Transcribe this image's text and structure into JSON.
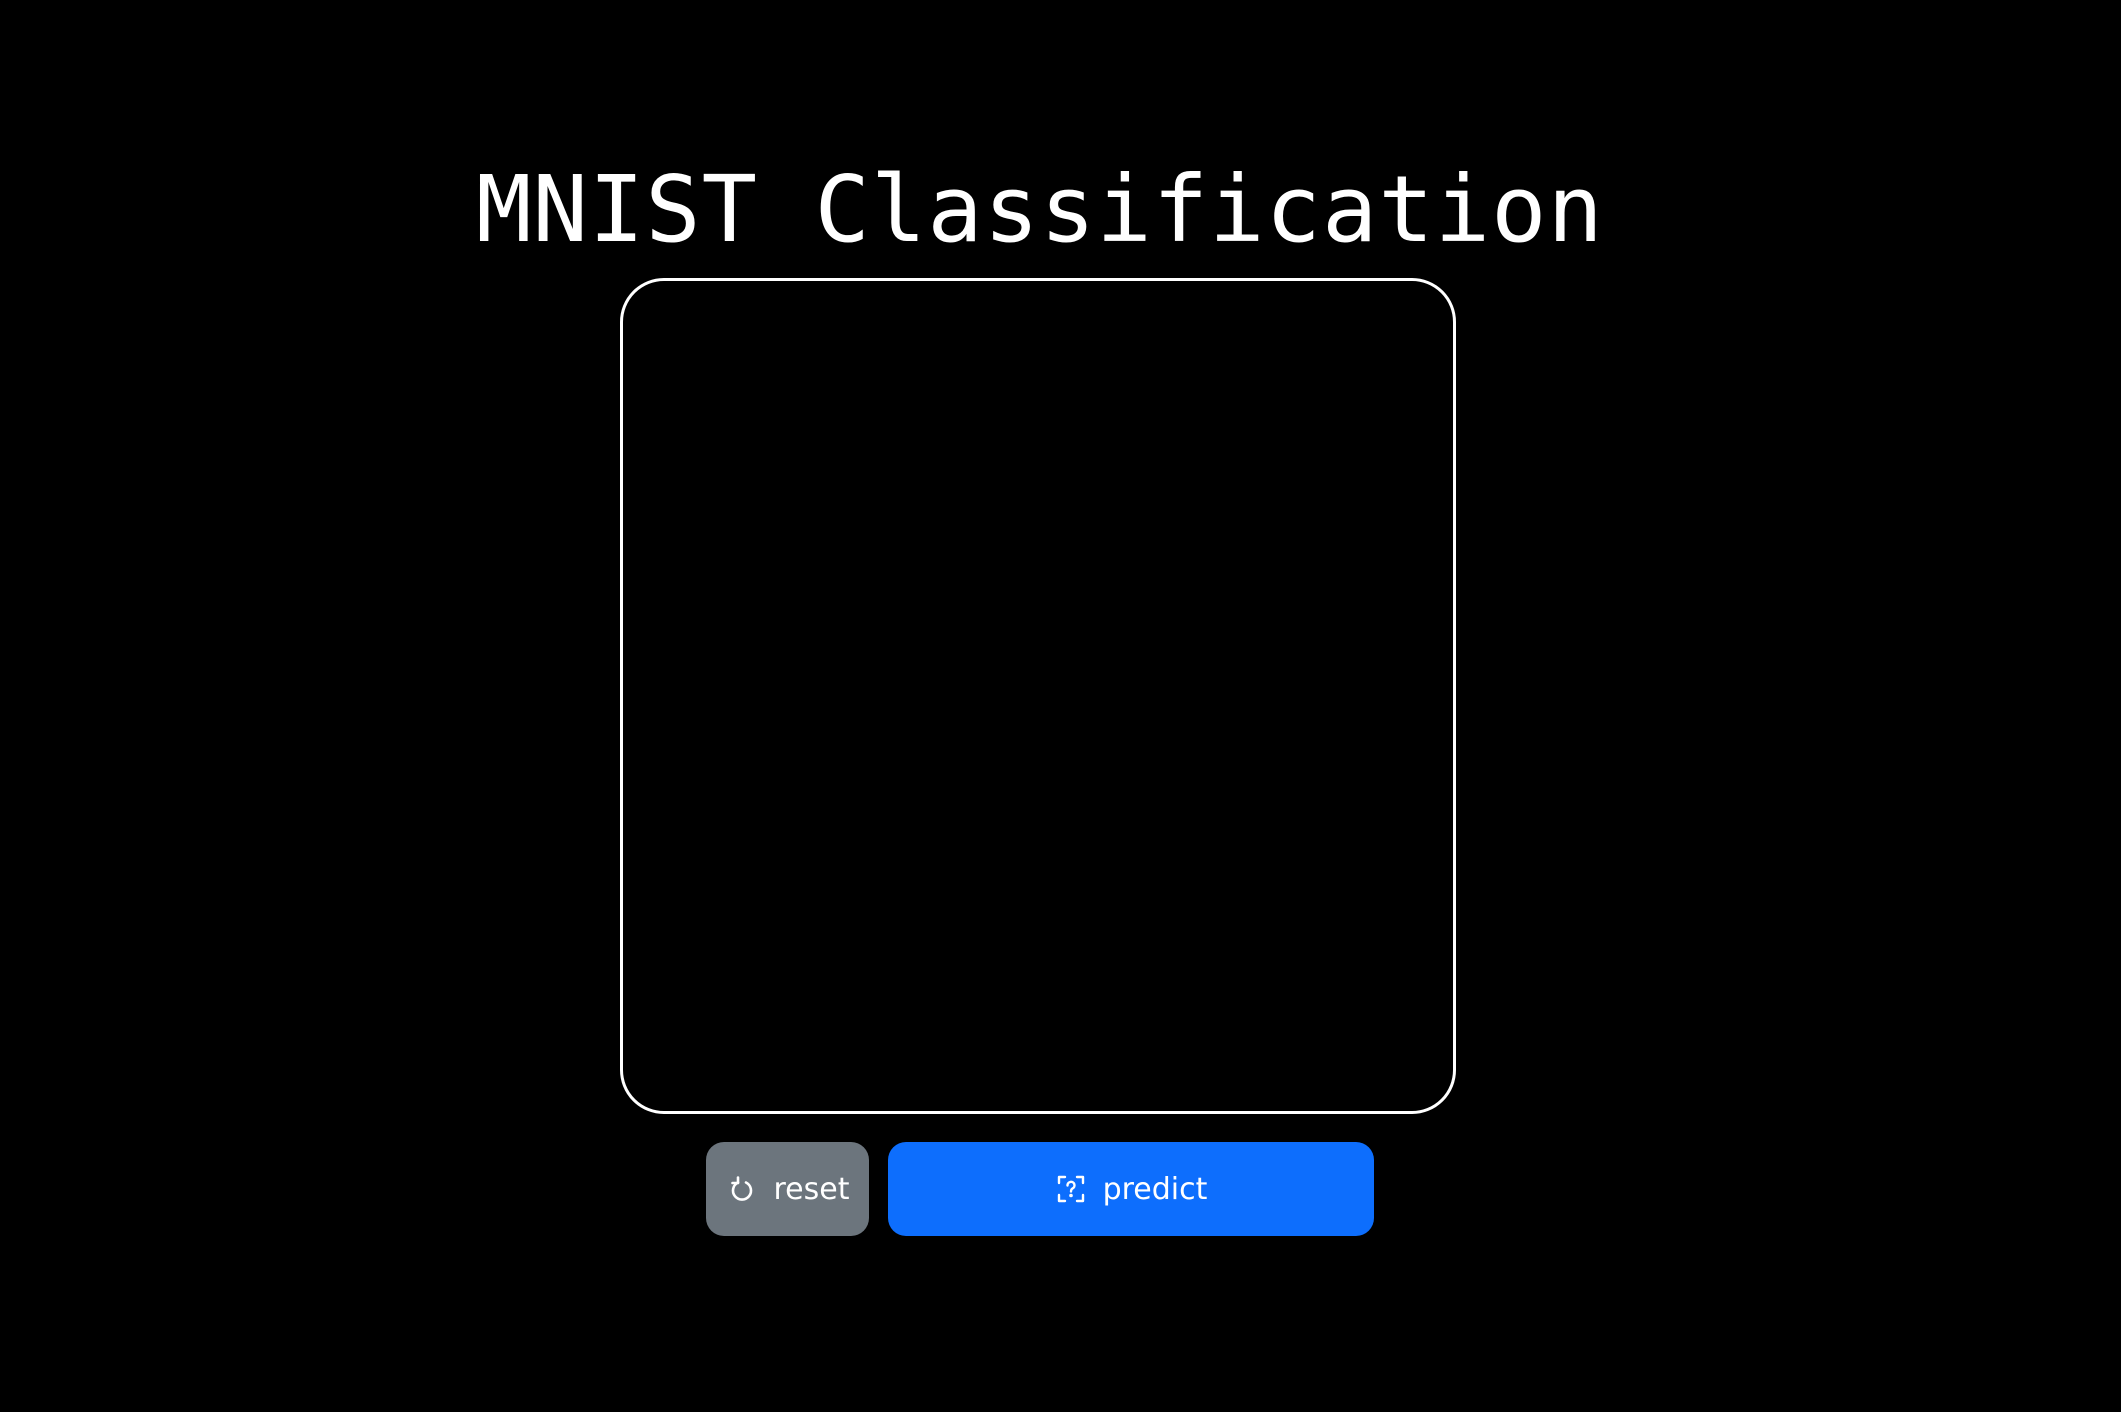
{
  "page": {
    "title": "MNIST Classification"
  },
  "canvas": {
    "label": "drawing canvas"
  },
  "buttons": {
    "reset": {
      "label": "reset",
      "icon": "reset-icon",
      "color": "#6c757d"
    },
    "predict": {
      "label": "predict",
      "icon": "scan-question-icon",
      "color": "#0d6efd"
    }
  },
  "colors": {
    "background": "#000000",
    "foreground": "#ffffff"
  }
}
